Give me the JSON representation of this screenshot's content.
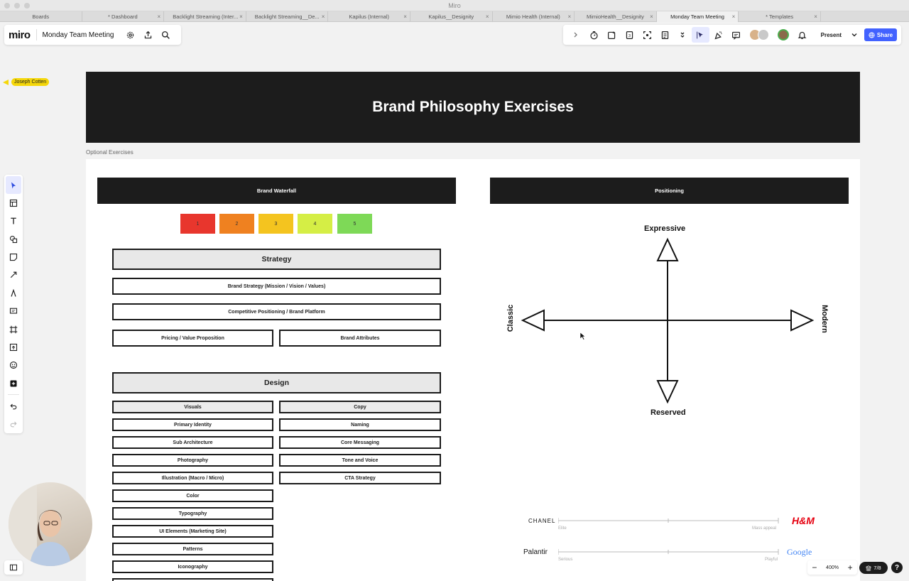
{
  "window": {
    "title": "Miro"
  },
  "tabs": [
    {
      "label": "Boards"
    },
    {
      "label": "* Dashboard"
    },
    {
      "label": "Backlight Streaming (Inter..."
    },
    {
      "label": "Backlight Streaming__De..."
    },
    {
      "label": "Kapilus (Internal)"
    },
    {
      "label": "Kapilus__Designity"
    },
    {
      "label": "Mimio Health (Internal)"
    },
    {
      "label": "MimioHealth__Designity"
    },
    {
      "label": "Monday Team Meeting"
    },
    {
      "label": "* Templates"
    }
  ],
  "header": {
    "logo": "miro",
    "board_name": "Monday Team Meeting",
    "present_label": "Present",
    "share_label": "Share"
  },
  "collaborator": {
    "name": "Joseph Cotten"
  },
  "board": {
    "hero_title": "Brand Philosophy Exercises",
    "frame_label": "Optional Exercises",
    "waterfall": {
      "header": "Brand Waterfall",
      "scale": [
        {
          "label": "1",
          "color": "#e8362d"
        },
        {
          "label": "2",
          "color": "#ef8120"
        },
        {
          "label": "3",
          "color": "#f4c41f"
        },
        {
          "label": "4",
          "color": "#d5ee45"
        },
        {
          "label": "5",
          "color": "#7ed957"
        }
      ],
      "strategy_title": "Strategy",
      "strategy_items": [
        "Brand Strategy (Mission / Vision / Values)",
        "Competitive Positioning / Brand Platform",
        "Pricing / Value Proposition",
        "Brand Attributes"
      ],
      "design_title": "Design",
      "visuals_header": "Visuals",
      "copy_header": "Copy",
      "visuals_items": [
        "Primary Identity",
        "Sub Architecture",
        "Photography",
        "Illustration (Macro / Micro)",
        "Color",
        "Typography",
        "UI Elements (Marketing Site)",
        "Patterns",
        "Iconography"
      ],
      "copy_items": [
        "Naming",
        "Core Messaging",
        "Tone and Voice",
        "CTA Strategy"
      ]
    },
    "positioning": {
      "header": "Positioning",
      "top": "Expressive",
      "bottom": "Reserved",
      "left": "Classic",
      "right": "Modern",
      "scales": [
        {
          "left_brand": "CHANEL",
          "left_label": "Elite",
          "right_label": "Mass appeal",
          "right_brand": "H&M"
        },
        {
          "left_brand": "Palantir",
          "left_label": "Serious",
          "right_label": "Playful",
          "right_brand": "Google"
        }
      ]
    }
  },
  "zoom": {
    "level": "400%"
  },
  "pages": {
    "label": "7/8"
  },
  "help": {
    "label": "?"
  }
}
